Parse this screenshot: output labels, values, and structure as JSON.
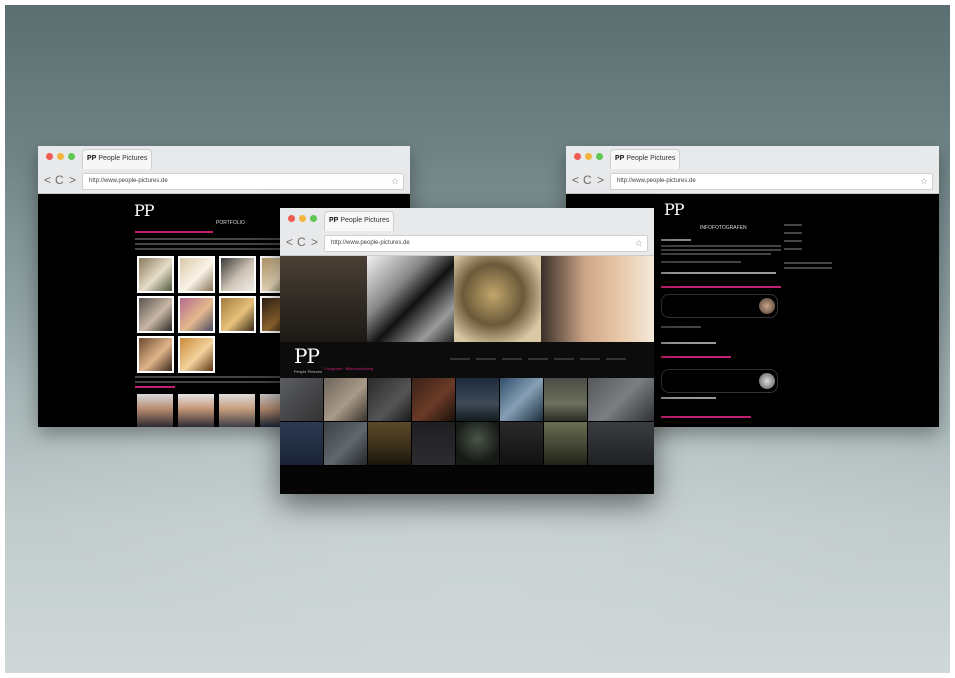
{
  "tab_title": "People Pictures",
  "tab_logo": "PP",
  "url": "http://www.people-pictures.de",
  "nav": {
    "back": "<",
    "reload": "C",
    "forward": ">",
    "bookmark": "☆"
  },
  "left_site": {
    "heading": "PORTFOLIO"
  },
  "center_site": {
    "logo_brand": "People Pictures",
    "logo_sub": "Fotografie · Bildbearbeitung"
  },
  "right_site": {
    "heading": "INFOFOTOGRAFEN"
  },
  "colors": {
    "accent": "#c3216f",
    "traffic_red": "#ee5b52",
    "traffic_yellow": "#f2b73b",
    "traffic_green": "#5fc553"
  }
}
